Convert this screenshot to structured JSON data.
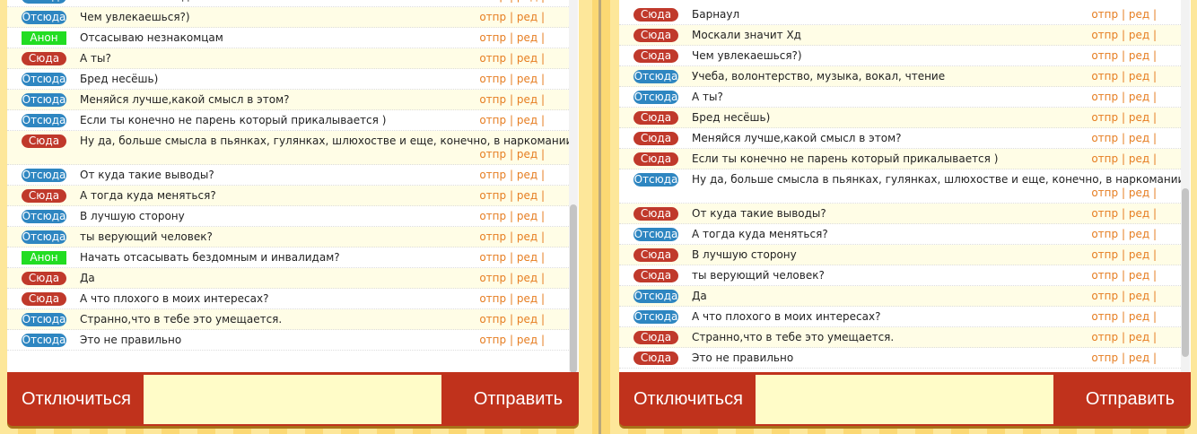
{
  "labels": {
    "from": "Отсюда",
    "to": "Сюда",
    "anon": "Анон"
  },
  "actions": {
    "send": "отпр",
    "edit": "ред",
    "sep": "|"
  },
  "colors": {
    "from_badge": "#2e86c1",
    "to_badge": "#c0392b",
    "anon_badge": "#22dd22",
    "action_link": "#e67e22",
    "bar": "#c0321c",
    "input_bg": "#fffcc8"
  },
  "left": {
    "messages": [
      {
        "who": "from",
        "text": "Москали значит Хд"
      },
      {
        "who": "from",
        "text": "Чем увлекаешься?)"
      },
      {
        "who": "anon",
        "text": "Отсасываю незнакомцам"
      },
      {
        "who": "to",
        "text": "А ты?"
      },
      {
        "who": "from",
        "text": "Бред несёшь)"
      },
      {
        "who": "from",
        "text": "Меняйся лучше,какой смысл в этом?"
      },
      {
        "who": "from",
        "text": "Если ты конечно не парень который прикалывается )"
      },
      {
        "who": "to",
        "text": "Ну да, больше смысла в пьянках, гулянках, шлюхостве и еще, конечно, в наркомании"
      },
      {
        "who": "from",
        "text": "От куда такие выводы?"
      },
      {
        "who": "to",
        "text": "А тогда куда меняться?"
      },
      {
        "who": "from",
        "text": "В лучшую сторону"
      },
      {
        "who": "from",
        "text": "ты верующий человек?"
      },
      {
        "who": "anon",
        "text": "Начать отсасывать бездомным и инвалидам?"
      },
      {
        "who": "to",
        "text": "Да"
      },
      {
        "who": "to",
        "text": "А что плохого в моих интересах?"
      },
      {
        "who": "from",
        "text": "Странно,что в тебе это умещается."
      },
      {
        "who": "from",
        "text": "Это не правильно"
      }
    ],
    "disconnect": "Отключиться",
    "send": "Отправить"
  },
  "right": {
    "messages": [
      {
        "who": "to",
        "text": "Барнаул"
      },
      {
        "who": "to",
        "text": "Москали значит Хд"
      },
      {
        "who": "to",
        "text": "Чем увлекаешься?)"
      },
      {
        "who": "from",
        "text": "Учеба, волонтерство, музыка, вокал, чтение"
      },
      {
        "who": "from",
        "text": "А ты?"
      },
      {
        "who": "to",
        "text": "Бред несёшь)"
      },
      {
        "who": "to",
        "text": "Меняйся лучше,какой смысл в этом?"
      },
      {
        "who": "to",
        "text": "Если ты конечно не парень который прикалывается )"
      },
      {
        "who": "from",
        "text": "Ну да, больше смысла в пьянках, гулянках, шлюхостве и еще, конечно, в наркомании"
      },
      {
        "who": "to",
        "text": "От куда такие выводы?"
      },
      {
        "who": "from",
        "text": "А тогда куда меняться?"
      },
      {
        "who": "to",
        "text": "В лучшую сторону"
      },
      {
        "who": "to",
        "text": "ты верующий человек?"
      },
      {
        "who": "from",
        "text": "Да"
      },
      {
        "who": "from",
        "text": "А что плохого в моих интересах?"
      },
      {
        "who": "to",
        "text": "Странно,что в тебе это умещается."
      },
      {
        "who": "to",
        "text": "Это не правильно"
      }
    ],
    "disconnect": "Отключиться",
    "send": "Отправить"
  }
}
